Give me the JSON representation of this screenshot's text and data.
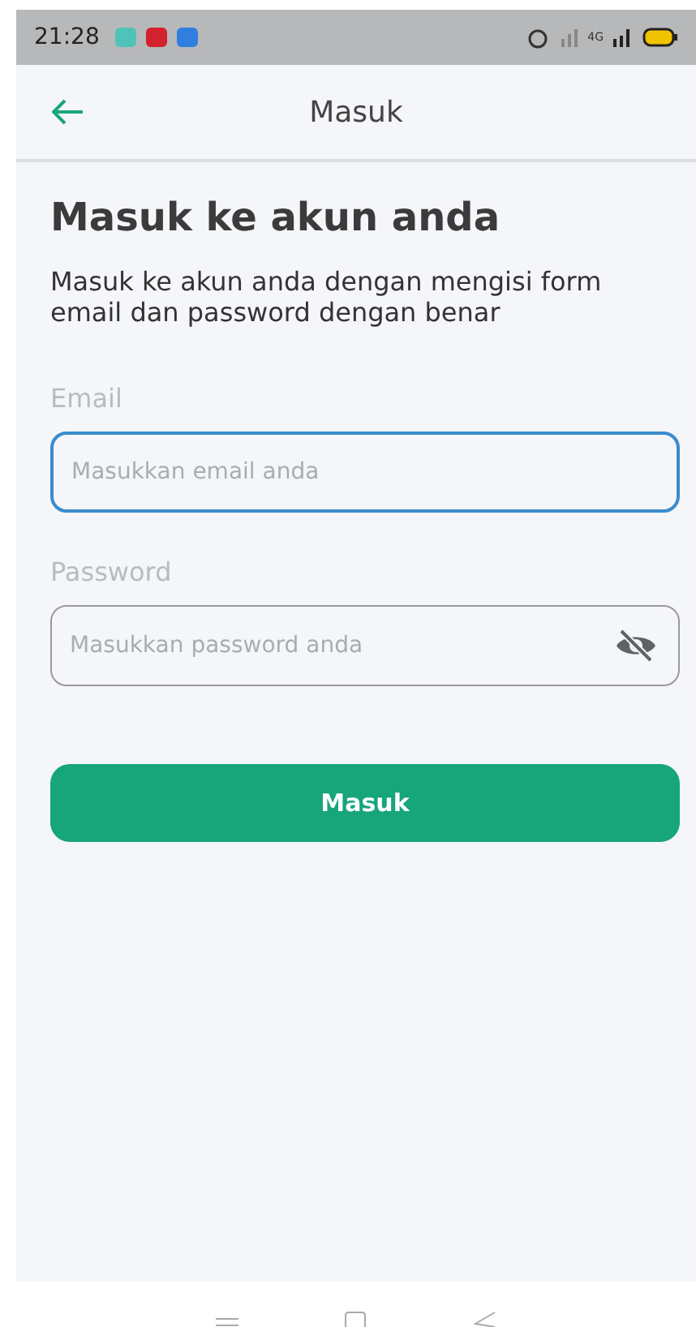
{
  "status_bar": {
    "time": "21:28",
    "network": "4G"
  },
  "app_bar": {
    "title": "Masuk"
  },
  "heading": "Masuk ke akun anda",
  "subtitle": "Masuk ke akun anda dengan mengisi form email dan password dengan benar",
  "fields": [
    {
      "label": "Email",
      "placeholder": "Masukkan email anda",
      "kind": "email",
      "focused": true
    },
    {
      "label": "Password",
      "placeholder": "Masukkan password anda",
      "kind": "password",
      "focused": false
    }
  ],
  "submit_button": "Masuk"
}
